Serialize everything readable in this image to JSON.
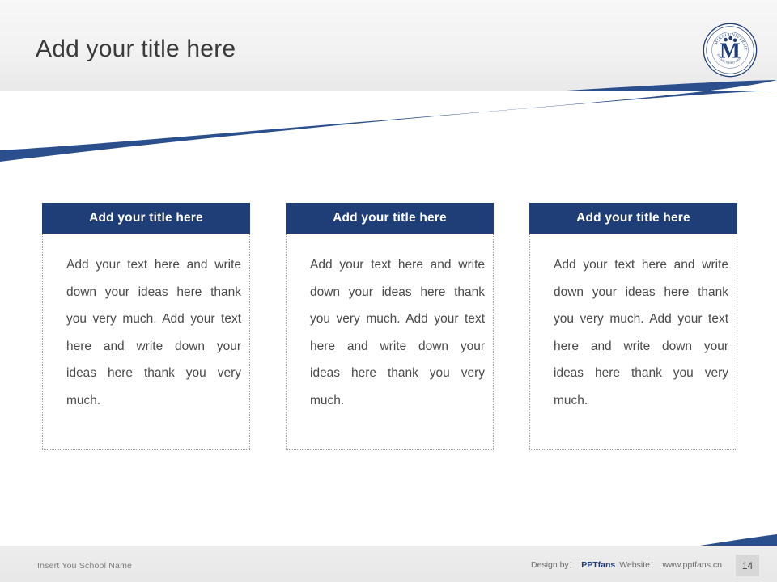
{
  "slide": {
    "title": "Add your title here",
    "page_number": "14",
    "accent_color": "#1f3e78",
    "background_color": "#ffffff"
  },
  "logo": {
    "icon": "university-seal-icon",
    "monogram": "M",
    "ring_text_top": "MIRAI UNIVERSITY",
    "ring_text_bottom": "ESTABLISHED 1909"
  },
  "columns": [
    {
      "heading": "Add your title here",
      "body": "Add your text here and write down your ideas here thank you very much. Add your text here and write down your ideas here thank you very much."
    },
    {
      "heading": "Add your title here",
      "body": "Add your text here and write down your ideas here thank you very much. Add your text here and write down your ideas here thank you very much."
    },
    {
      "heading": "Add your title here",
      "body": "Add your text here and write down your ideas here thank you very much. Add your text here and write down your ideas here thank you very much."
    }
  ],
  "footer": {
    "school_name": "Insert You School Name",
    "design_by_label": "Design by：",
    "design_by_value": "PPTfans",
    "website_label": "Website：",
    "website_value": "www.pptfans.cn"
  }
}
